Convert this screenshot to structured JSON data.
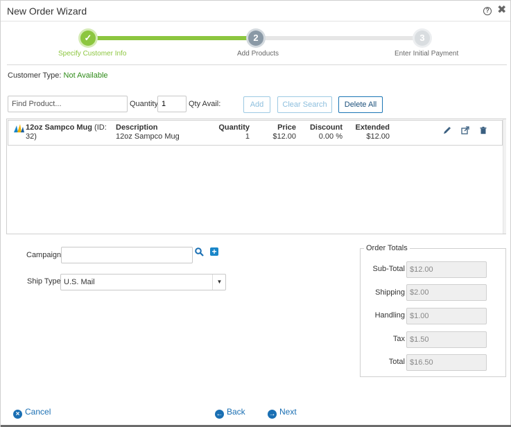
{
  "window": {
    "title": "New Order Wizard"
  },
  "wizard": {
    "steps": [
      {
        "number": "✓",
        "label": "Specify Customer Info",
        "state": "complete"
      },
      {
        "number": "2",
        "label": "Add Products",
        "state": "active"
      },
      {
        "number": "3",
        "label": "Enter Initial Payment",
        "state": "pending"
      }
    ]
  },
  "customer": {
    "type_label": "Customer Type:",
    "type_value": "Not Available"
  },
  "product_search": {
    "find_placeholder": "Find Product...",
    "quantity_label": "Quantity",
    "quantity_value": "1",
    "qty_avail_label": "Qty Avail:",
    "add_label": "Add",
    "clear_label": "Clear Search",
    "delete_all_label": "Delete All"
  },
  "grid": {
    "rows": [
      {
        "name": "12oz Sampco Mug",
        "id_text": "(ID:",
        "id_value": "32)",
        "description_header": "Description",
        "description": "12oz Sampco Mug",
        "quantity_header": "Quantity",
        "quantity": "1",
        "price_header": "Price",
        "price": "$12.00",
        "discount_header": "Discount",
        "discount": "0.00 %",
        "extended_header": "Extended",
        "extended": "$12.00"
      }
    ]
  },
  "campaign": {
    "label": "Campaign",
    "value": ""
  },
  "ship": {
    "label": "Ship Type",
    "value": "U.S. Mail"
  },
  "totals": {
    "legend": "Order Totals",
    "subtotal_label": "Sub-Total",
    "subtotal": "$12.00",
    "shipping_label": "Shipping",
    "shipping": "$2.00",
    "handling_label": "Handling",
    "handling": "$1.00",
    "tax_label": "Tax",
    "tax": "$1.50",
    "total_label": "Total",
    "total": "$16.50"
  },
  "footer": {
    "cancel_label": "Cancel",
    "back_label": "Back",
    "next_label": "Next"
  },
  "colors": {
    "accent": "#1a6fb3",
    "success": "#8cc63f",
    "status_text": "#2e8b18"
  }
}
